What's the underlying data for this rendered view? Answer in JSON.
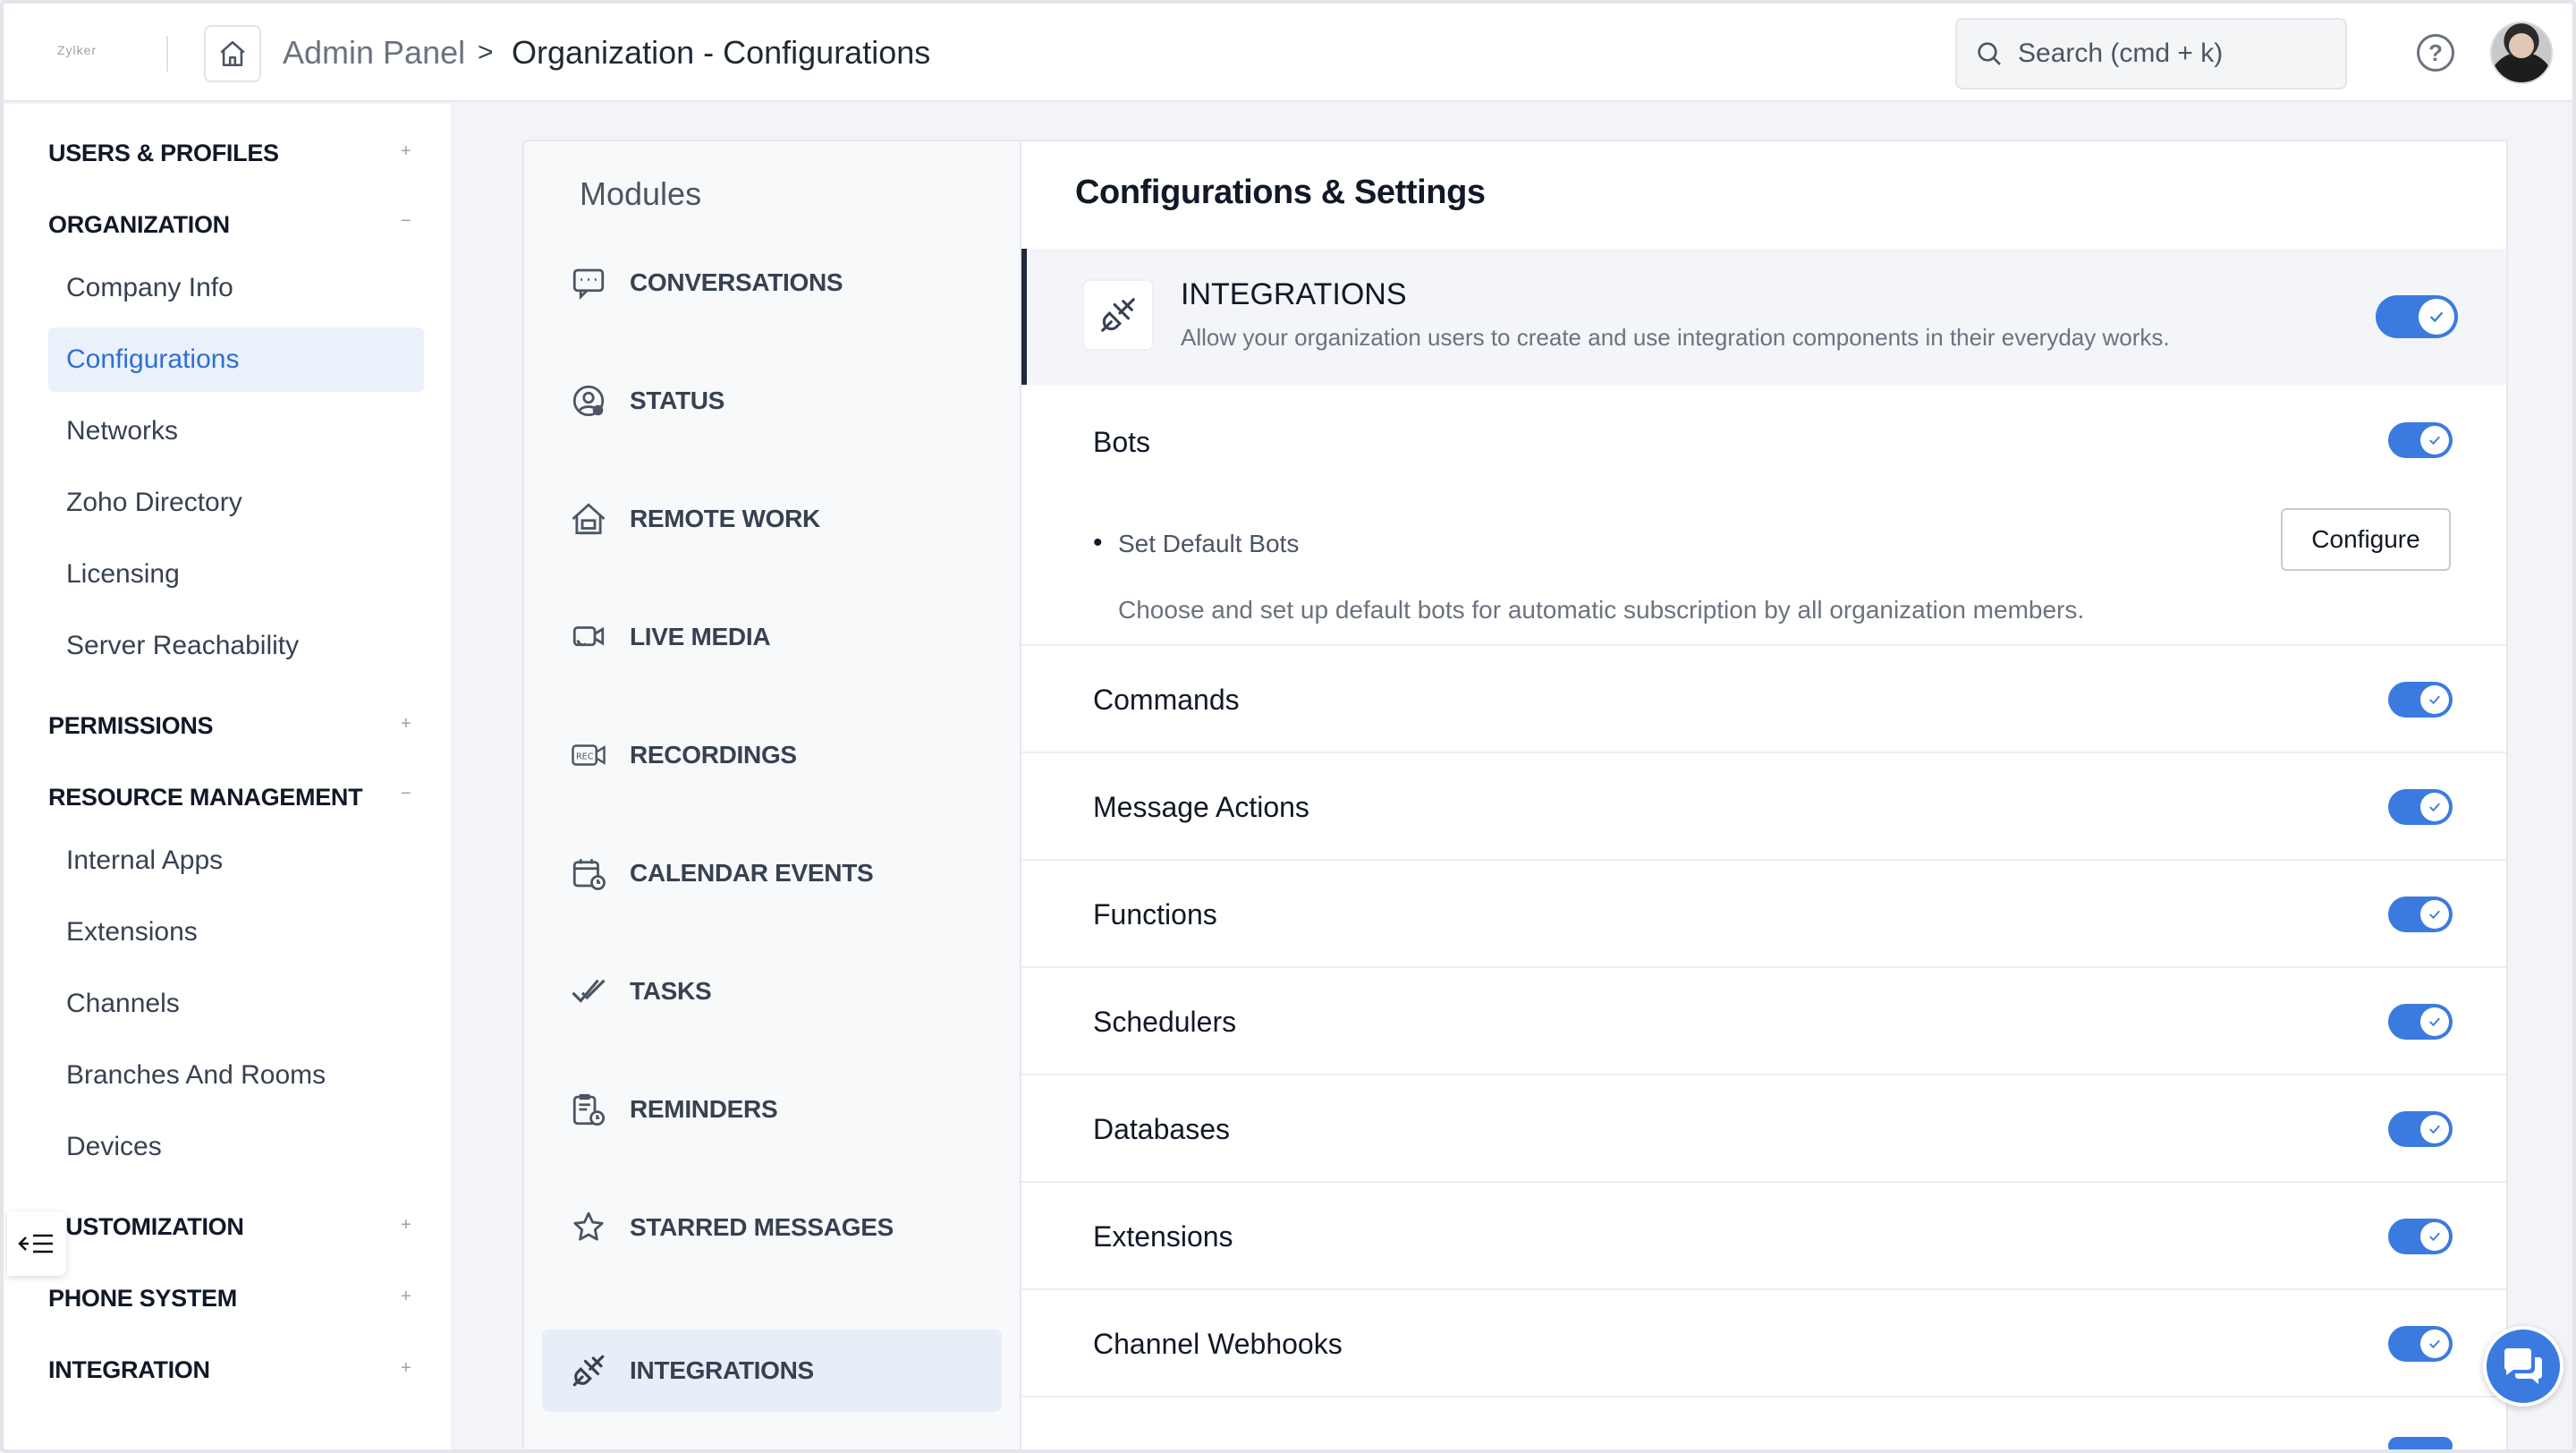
{
  "header": {
    "logo_text": "Zylker",
    "breadcrumb_root": "Admin Panel",
    "breadcrumb_sep": ">",
    "breadcrumb_page": "Organization - Configurations",
    "search_placeholder": "Search (cmd + k)"
  },
  "sidebar": {
    "sections": [
      {
        "label": "USERS & PROFILES",
        "sign": "+"
      },
      {
        "label": "ORGANIZATION",
        "sign": "−"
      },
      {
        "label": "PERMISSIONS",
        "sign": "+"
      },
      {
        "label": "RESOURCE MANAGEMENT",
        "sign": "−"
      },
      {
        "label": "CUSTOMIZATION",
        "sign": "+"
      },
      {
        "label": "PHONE SYSTEM",
        "sign": "+"
      },
      {
        "label": "INTEGRATION",
        "sign": "+"
      }
    ],
    "organization_items": [
      "Company Info",
      "Configurations",
      "Networks",
      "Zoho Directory",
      "Licensing",
      "Server Reachability"
    ],
    "resource_items": [
      "Internal Apps",
      "Extensions",
      "Channels",
      "Branches And Rooms",
      "Devices"
    ],
    "active_item": "Configurations"
  },
  "modules": {
    "title": "Modules",
    "items": [
      {
        "label": "CONVERSATIONS",
        "icon": "chat-icon"
      },
      {
        "label": "STATUS",
        "icon": "status-icon"
      },
      {
        "label": "REMOTE WORK",
        "icon": "remote-work-icon"
      },
      {
        "label": "LIVE MEDIA",
        "icon": "live-media-icon"
      },
      {
        "label": "RECORDINGS",
        "icon": "rec-icon"
      },
      {
        "label": "CALENDAR EVENTS",
        "icon": "calendar-icon"
      },
      {
        "label": "TASKS",
        "icon": "tasks-icon"
      },
      {
        "label": "REMINDERS",
        "icon": "reminders-icon"
      },
      {
        "label": "STARRED MESSAGES",
        "icon": "star-icon"
      },
      {
        "label": "INTEGRATIONS",
        "icon": "plug-icon"
      }
    ],
    "active": "INTEGRATIONS"
  },
  "settings": {
    "title": "Configurations & Settings",
    "integration": {
      "title": "INTEGRATIONS",
      "description": "Allow your organization users to create and use integration components in their everyday works.",
      "enabled": true
    },
    "bots": {
      "label": "Bots",
      "enabled": true,
      "sub_label": "Set Default Bots",
      "sub_description": "Choose and set up default bots for automatic subscription by all organization members.",
      "configure_label": "Configure"
    },
    "rows": [
      {
        "label": "Commands",
        "enabled": true
      },
      {
        "label": "Message Actions",
        "enabled": true
      },
      {
        "label": "Functions",
        "enabled": true
      },
      {
        "label": "Schedulers",
        "enabled": true
      },
      {
        "label": "Databases",
        "enabled": true
      },
      {
        "label": "Extensions",
        "enabled": true
      },
      {
        "label": "Channel Webhooks",
        "enabled": true
      }
    ]
  },
  "colors": {
    "accent": "#3b7be0",
    "active_bg": "#eaf1fb",
    "active_text": "#2f6fd0"
  }
}
